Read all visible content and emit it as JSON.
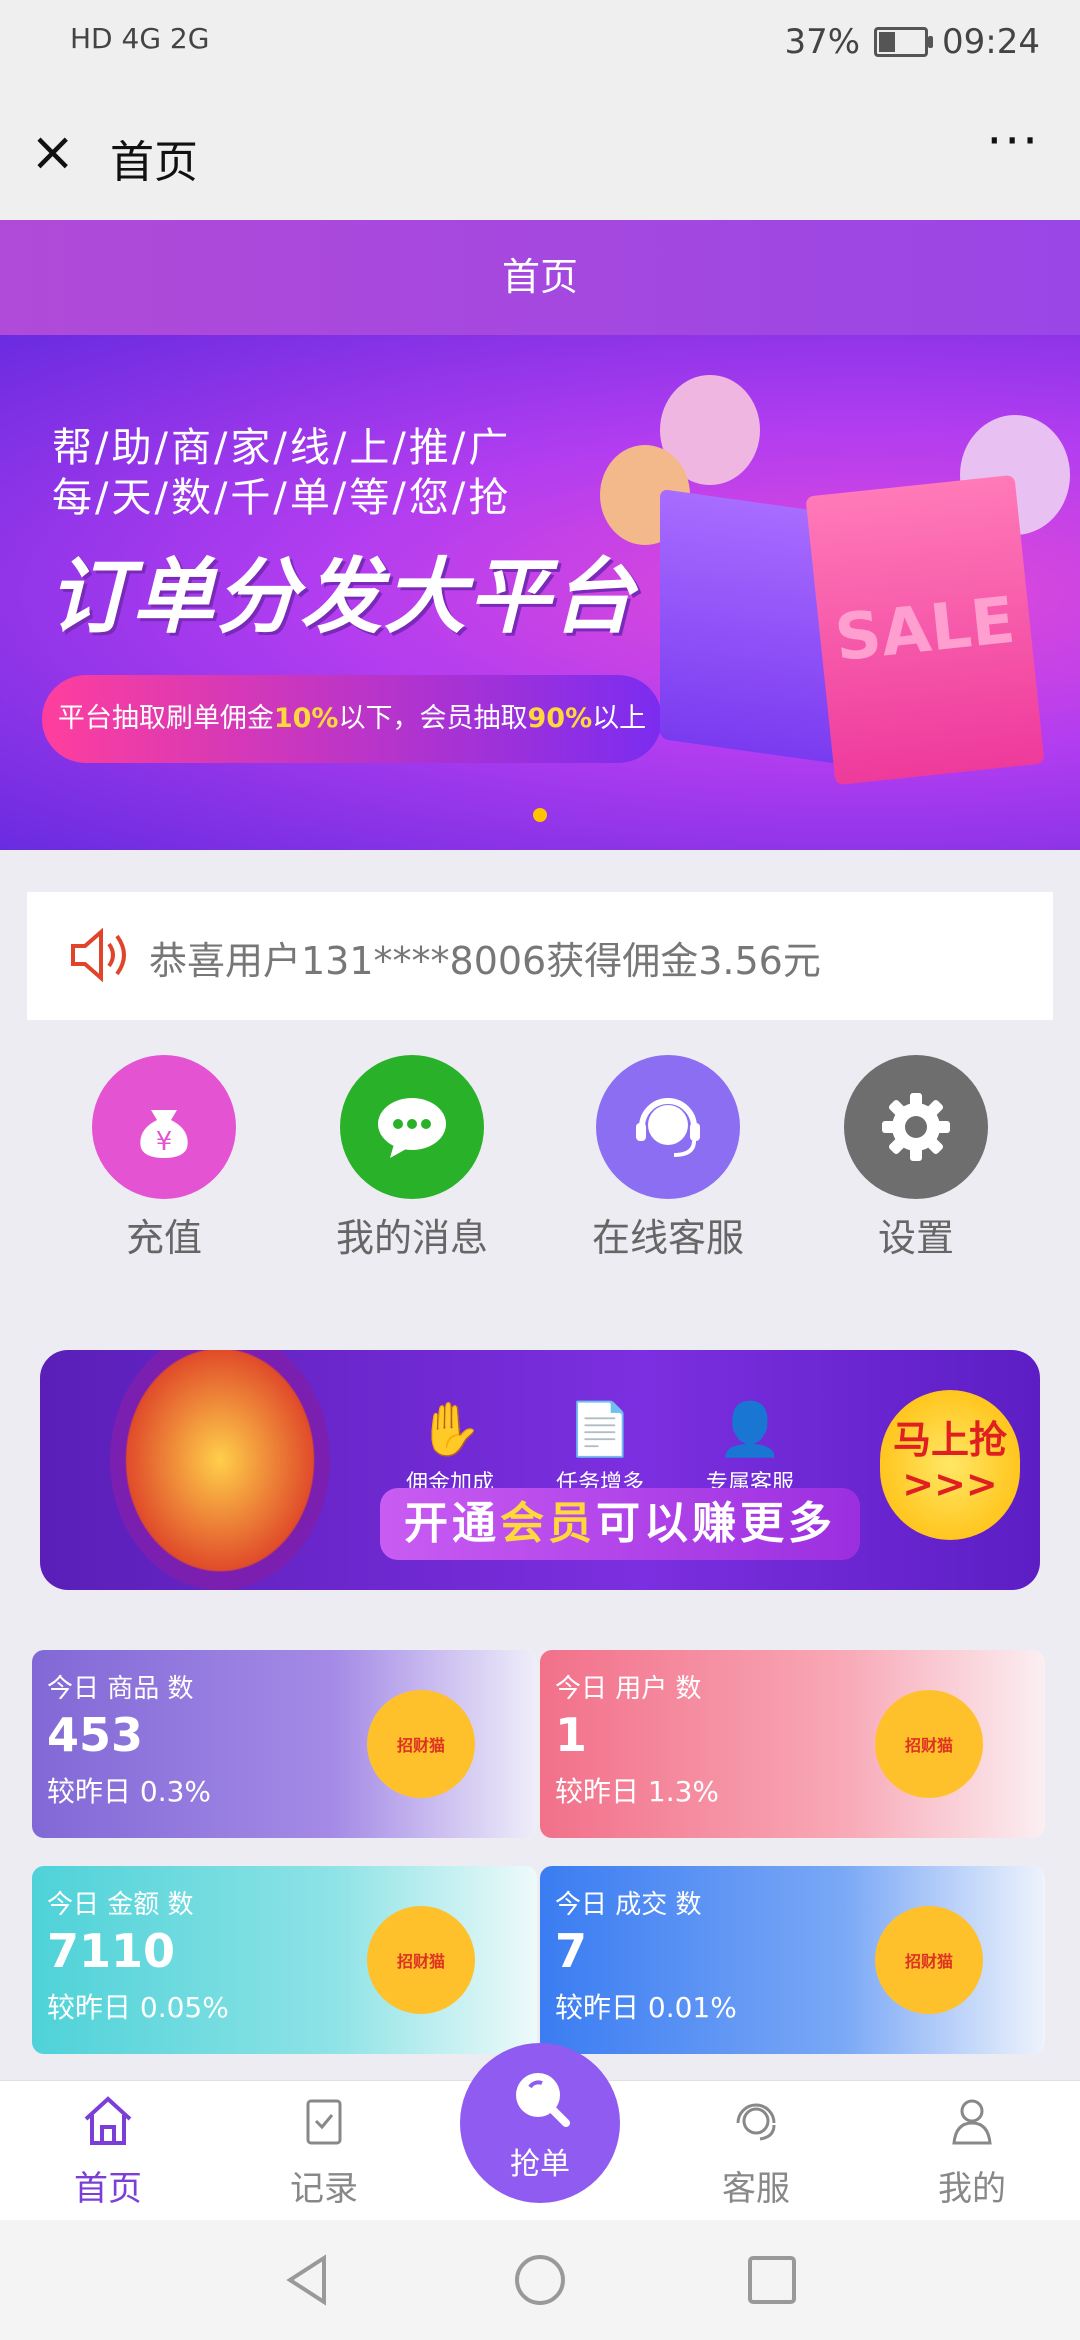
{
  "status": {
    "left": "HD 4G 2G",
    "battery": "37%",
    "time": "09:24"
  },
  "titlebar": {
    "close": "×",
    "title": "首页",
    "more": "···"
  },
  "page_header": "首页",
  "banner": {
    "line1": "帮/助/商/家/线/上/推/广",
    "line2": "每/天/数/千/单/等/您/抢",
    "headline": "订单分发大平台",
    "pill_a": "平台抽取刷单佣金",
    "pill_b": "10%",
    "pill_c": "以下，会员抽取",
    "pill_d": "90%",
    "pill_e": "以上",
    "bag_text": "SALE"
  },
  "notice": "恭喜用户131****8006获得佣金3.56元",
  "quick": [
    {
      "label": "充值",
      "color": "#e454d2",
      "icon": "money-bag-icon"
    },
    {
      "label": "我的消息",
      "color": "#29b12a",
      "icon": "chat-icon"
    },
    {
      "label": "在线客服",
      "color": "#8c6ef2",
      "icon": "headset-icon"
    },
    {
      "label": "设置",
      "color": "#6e6e6e",
      "icon": "gear-icon"
    }
  ],
  "promo": {
    "f1": "佣金加成",
    "f2": "任务增多",
    "f3": "专属客服",
    "cta_a": "开通",
    "cta_b": "会员",
    "cta_c": "可以赚更多",
    "go": "马上抢",
    "go_arrows": ">>>"
  },
  "stats": [
    {
      "title": "今日 商品 数",
      "value": "453",
      "change": "较昨日 0.3%"
    },
    {
      "title": "今日 用户 数",
      "value": "1",
      "change": "较昨日 1.3%"
    },
    {
      "title": "今日 金额 数",
      "value": "7110",
      "change": "较昨日 0.05%"
    },
    {
      "title": "今日 成交 数",
      "value": "7",
      "change": "较昨日 0.01%"
    }
  ],
  "badge": "招财猫",
  "tabs": {
    "home": "首页",
    "records": "记录",
    "grab": "抢单",
    "service": "客服",
    "mine": "我的"
  },
  "colors": {
    "accent": "#7b3fd8",
    "purple": "#9a46e6"
  }
}
